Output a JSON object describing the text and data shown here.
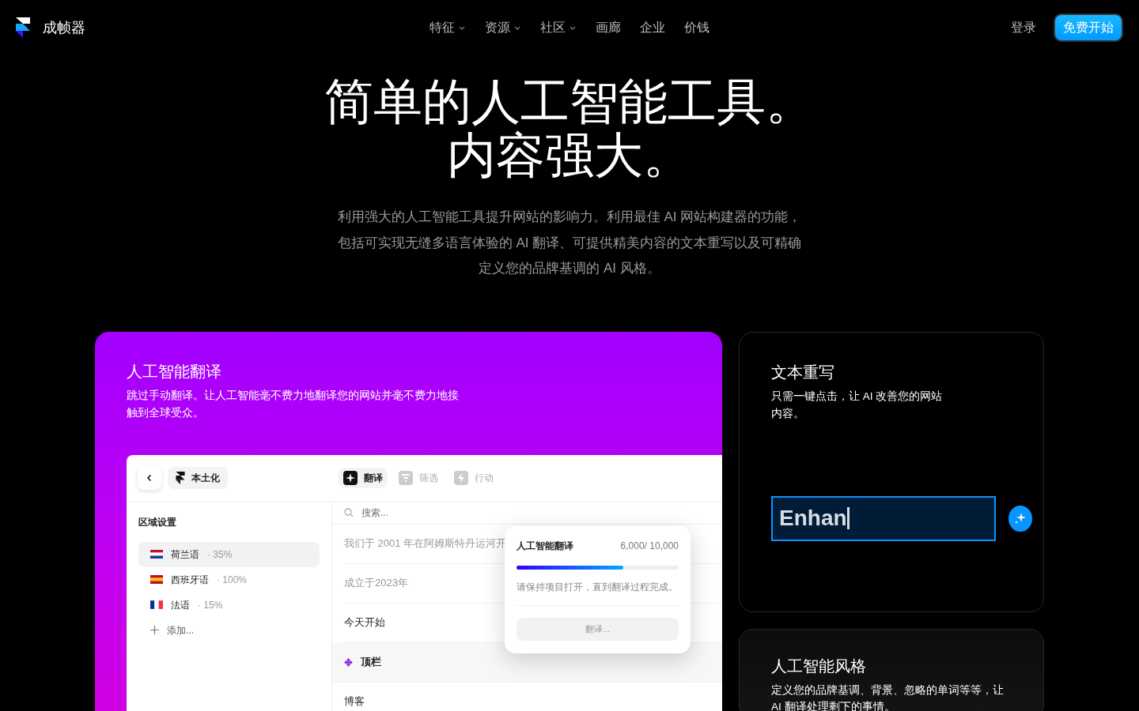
{
  "nav": {
    "brand": "成帧器",
    "menu": [
      {
        "label": "特征",
        "dropdown": true
      },
      {
        "label": "资源",
        "dropdown": true
      },
      {
        "label": "社区",
        "dropdown": true
      },
      {
        "label": "画廊",
        "dropdown": false
      },
      {
        "label": "企业",
        "dropdown": false
      },
      {
        "label": "价钱",
        "dropdown": false
      }
    ],
    "login": "登录",
    "cta": "免费开始"
  },
  "hero": {
    "title_lines": [
      "简单的人工智能工具。",
      "内容强大。"
    ],
    "subtitle": "利用强大的人工智能工具提升网站的影响力。利用最佳 AI 网站构建器的功能，包括可实现无缝多语言体验的 AI 翻译、可提供精美内容的文本重写以及可精确定义您的品牌基调的 AI 风格。"
  },
  "translation_card": {
    "title": "人工智能翻译",
    "description": "跳过手动翻译。让人工智能毫不费力地翻译您的网站并毫不费力地接触到全球受众。",
    "app": {
      "project": "本土化",
      "tools": [
        {
          "label": "翻译",
          "kind": "sparkle",
          "selected": true
        },
        {
          "label": "筛选",
          "kind": "filter",
          "selected": false
        },
        {
          "label": "行动",
          "kind": "bolt",
          "selected": false
        }
      ],
      "section_title": "区域设置",
      "locales": [
        {
          "name": "荷兰语",
          "percent": "· 35%",
          "kind": "nl",
          "selected": true
        },
        {
          "name": "西班牙语",
          "percent": "· 100%",
          "kind": "es",
          "selected": false
        },
        {
          "name": "法语",
          "percent": "·  15%",
          "kind": "fr",
          "selected": false
        }
      ],
      "add_label": "添加...",
      "search_placeholder": "搜索...",
      "rows": [
        {
          "text": "我们于 2001 年在阿姆斯特丹运河开",
          "kind": "text",
          "muted": true,
          "selected": false
        },
        {
          "text": "成立于2023年",
          "kind": "text",
          "muted": true,
          "selected": false
        },
        {
          "text": "今天开始",
          "kind": "text",
          "muted": false,
          "selected": false
        },
        {
          "text": "顶栏",
          "kind": "component",
          "muted": false,
          "selected": true
        },
        {
          "text": "博客",
          "kind": "text",
          "muted": false,
          "selected": false
        }
      ],
      "popup": {
        "title": "人工智能翻译",
        "count": "6,000/ 10,000",
        "level": 0.66,
        "note": "请保持项目打开，直到翻译过程完成。",
        "button": "翻译..."
      }
    }
  },
  "rewrite_card": {
    "title": "文本重写",
    "description": "只需一键点击，让 AI 改善您的网站内容。",
    "input_value": "Enhan"
  },
  "style_card": {
    "title": "人工智能风格",
    "description": "定义您的品牌基调、背景、忽略的单词等等，让 AI 翻译处理剩下的事情。"
  }
}
